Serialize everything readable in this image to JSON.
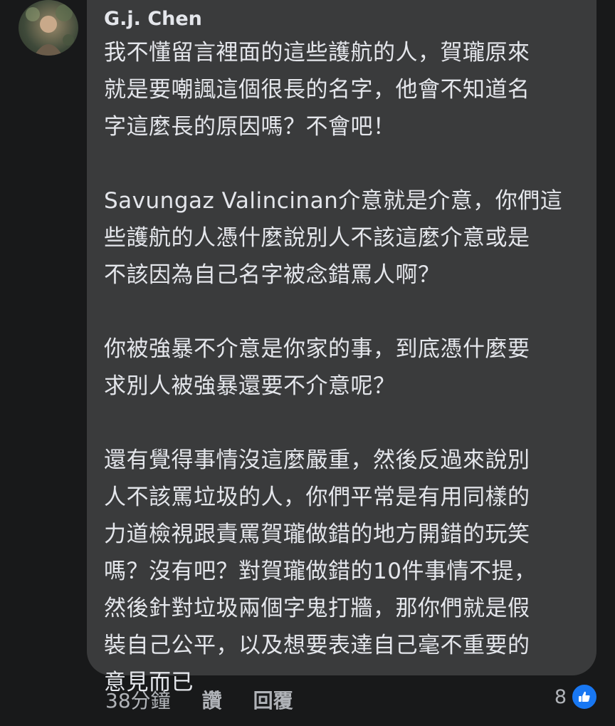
{
  "comment": {
    "author": "G.j. Chen",
    "lines": [
      "我不懂留言裡面的這些護航的人，賀瓏原來",
      "就是要嘲諷這個很長的名字，他會不知道名",
      "字這麼長的原因嗎？不會吧！",
      "",
      "Savungaz Valincinan介意就是介意，你們這",
      "些護航的人憑什麼說別人不該這麼介意或是",
      "不該因為自己名字被念錯罵人啊？",
      "",
      "你被強暴不介意是你家的事，到底憑什麼要",
      "求別人被強暴還要不介意呢？",
      "",
      "還有覺得事情沒這麼嚴重，然後反過來說別",
      "人不該罵垃圾的人，你們平常是有用同樣的",
      "力道檢視跟責罵賀瓏做錯的地方開錯的玩笑",
      "嗎？沒有吧？對賀瓏做錯的10件事情不提，",
      "然後針對垃圾兩個字鬼打牆，那你們就是假",
      "裝自己公平，以及想要表達自己毫不重要的",
      "意見而已"
    ]
  },
  "actions": {
    "time": "38分鐘",
    "like": "讚",
    "reply": "回覆"
  },
  "reactions": {
    "count": "8",
    "icon": "thumbs-up-icon",
    "color": "#1877f2"
  }
}
